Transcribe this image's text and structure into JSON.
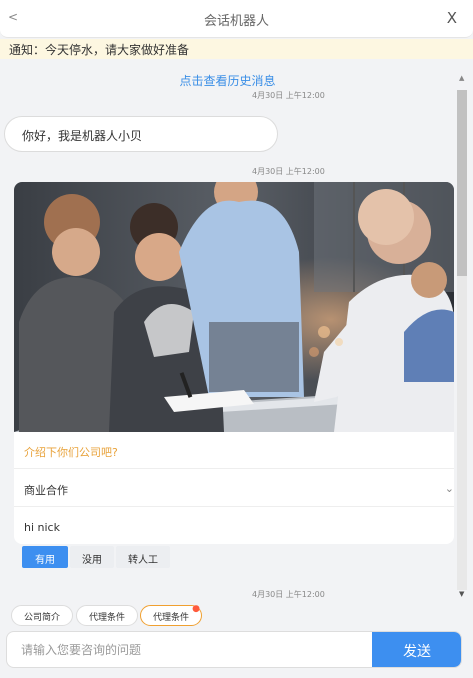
{
  "header": {
    "back_label": "<",
    "title": "会话机器人",
    "close_label": "X"
  },
  "notice": {
    "text": "通知：今天停水，请大家做好准备"
  },
  "chat": {
    "history_link": "点击查看历史消息",
    "timestamps": [
      "4月30日 上午12:00",
      "4月30日 上午12:00",
      "4月30日 上午12:00"
    ],
    "bot_greeting": "你好，我是机器人小贝",
    "card": {
      "image": "meeting-photo",
      "question": "介绍下你们公司吧?",
      "category": "商业合作",
      "reply": "hi nick"
    },
    "feedback": {
      "useful": "有用",
      "useless": "没用",
      "human": "转人工"
    }
  },
  "quick_replies": [
    "公司简介",
    "代理条件",
    "代理条件"
  ],
  "composer": {
    "placeholder": "请输入您要咨询的问题",
    "send_label": "发送"
  },
  "colors": {
    "accent": "#3d8ff0",
    "notice_bg": "#fdf7e1",
    "question": "#e8a23a",
    "badge": "#ff5a3c"
  }
}
